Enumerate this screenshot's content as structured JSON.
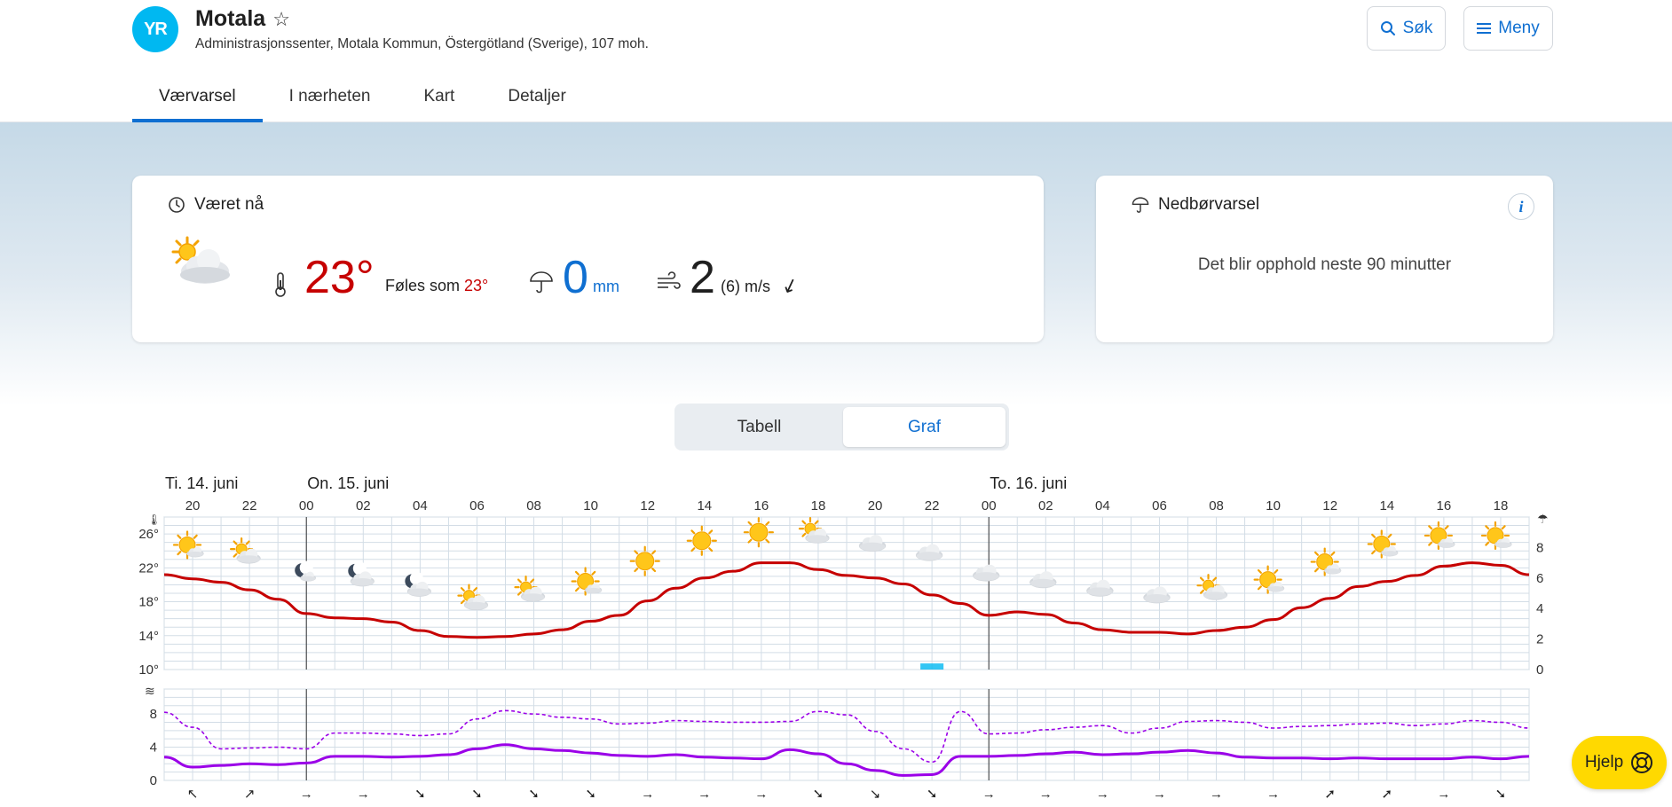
{
  "app": {
    "logo_text": "YR",
    "location_name": "Motala",
    "location_sub": "Administrasjonssenter, Motala Kommun, Östergötland (Sverige), 107 moh.",
    "search_label": "Søk",
    "menu_label": "Meny",
    "icons": {
      "logo": "yr-logo-icon",
      "star": "star-icon",
      "search": "search-icon",
      "menu": "hamburger-icon"
    }
  },
  "tabs": [
    {
      "label": "Værvarsel",
      "active": true
    },
    {
      "label": "I nærheten",
      "active": false
    },
    {
      "label": "Kart",
      "active": false
    },
    {
      "label": "Detaljer",
      "active": false
    }
  ],
  "now": {
    "title": "Været nå",
    "temperature": "23°",
    "feels_label": "Føles som",
    "feels_value": "23°",
    "precip_value": "0",
    "precip_unit": "mm",
    "wind_value": "2",
    "wind_detail": "(6) m/s",
    "wind_arrow": "↙",
    "icons": {
      "clock": "clock-icon",
      "weather": "partly-cloudy-day-icon",
      "thermometer": "thermometer-icon",
      "umbrella": "umbrella-icon",
      "wind": "wind-icon"
    }
  },
  "precip_card": {
    "title": "Nedbørvarsel",
    "message": "Det blir opphold neste 90 minutter",
    "info_label": "i"
  },
  "view_toggle": {
    "table_label": "Tabell",
    "graph_label": "Graf",
    "selected": "Graf"
  },
  "help": {
    "label": "Hjelp"
  },
  "colors": {
    "accent": "#0f6fd1",
    "temp": "#c60000",
    "wind": "#9b00e8",
    "rain": "#00b8f1",
    "help": "#ffd900"
  },
  "chart_data": {
    "type": "line",
    "days": [
      {
        "label": "Ti. 14. juni",
        "start_hour": 19
      },
      {
        "label": "On. 15. juni",
        "start_hour": 0
      },
      {
        "label": "To. 16. juni",
        "start_hour": 0
      }
    ],
    "hour_ticks": [
      "20",
      "22",
      "00",
      "02",
      "04",
      "06",
      "08",
      "10",
      "12",
      "14",
      "16",
      "18",
      "20",
      "22",
      "00",
      "02",
      "04",
      "06",
      "08",
      "10",
      "12",
      "14",
      "16",
      "18"
    ],
    "x": [
      "19",
      "20",
      "21",
      "22",
      "23",
      "00",
      "01",
      "02",
      "03",
      "04",
      "05",
      "06",
      "07",
      "08",
      "09",
      "10",
      "11",
      "12",
      "13",
      "14",
      "15",
      "16",
      "17",
      "18",
      "19",
      "20",
      "21",
      "22",
      "23",
      "00",
      "01",
      "02",
      "03",
      "04",
      "05",
      "06",
      "07",
      "08",
      "09",
      "10",
      "11",
      "12",
      "13",
      "14",
      "15",
      "16",
      "17",
      "18",
      "19"
    ],
    "temperature_axis": {
      "ticks": [
        "26°",
        "22°",
        "18°",
        "14°",
        "10°"
      ],
      "ylim": [
        10,
        28
      ]
    },
    "precip_axis": {
      "ticks": [
        "8",
        "6",
        "4",
        "2",
        "0"
      ],
      "ylim": [
        0,
        10
      ]
    },
    "wind_axis": {
      "ticks": [
        "8",
        "4",
        "0"
      ],
      "ylim": [
        0,
        11
      ]
    },
    "series": [
      {
        "name": "temperature",
        "unit": "°C",
        "values": [
          21.2,
          20.7,
          20.3,
          19.4,
          18.3,
          16.6,
          16.1,
          16.0,
          15.6,
          14.6,
          13.9,
          13.8,
          13.9,
          14.2,
          14.7,
          15.7,
          16.4,
          18.1,
          19.6,
          20.8,
          21.6,
          22.6,
          22.6,
          21.8,
          21.1,
          20.8,
          20.1,
          18.8,
          17.8,
          16.4,
          16.8,
          16.5,
          15.5,
          14.7,
          14.4,
          14.4,
          14.2,
          14.6,
          15.0,
          15.9,
          17.3,
          18.4,
          19.8,
          20.4,
          21.1,
          22.2,
          22.6,
          22.3,
          21.2
        ]
      },
      {
        "name": "wind",
        "unit": "m/s",
        "values": [
          2.8,
          1.6,
          1.8,
          2.0,
          1.9,
          2.1,
          2.9,
          2.9,
          2.8,
          2.9,
          3.1,
          3.8,
          4.3,
          3.8,
          3.6,
          3.3,
          3.0,
          2.9,
          3.1,
          2.8,
          2.7,
          2.6,
          3.7,
          3.2,
          2.0,
          1.2,
          0.6,
          0.7,
          2.9,
          2.9,
          3.0,
          3.2,
          3.4,
          3.1,
          3.2,
          3.4,
          3.6,
          3.3,
          2.8,
          2.7,
          2.7,
          2.6,
          2.7,
          2.6,
          2.6,
          2.6,
          2.8,
          2.6,
          2.9
        ]
      },
      {
        "name": "wind_gust",
        "unit": "m/s",
        "values": [
          8.2,
          6.4,
          3.8,
          3.9,
          4.0,
          3.8,
          5.7,
          5.7,
          5.6,
          5.4,
          5.6,
          7.4,
          8.4,
          8.0,
          7.6,
          7.4,
          6.8,
          6.9,
          7.2,
          7.1,
          7.0,
          7.0,
          7.1,
          8.3,
          7.9,
          5.9,
          3.8,
          2.2,
          8.3,
          5.6,
          5.7,
          6.1,
          6.4,
          6.6,
          5.7,
          6.3,
          7.1,
          7.2,
          7.0,
          6.3,
          6.5,
          6.6,
          6.8,
          6.9,
          6.6,
          6.8,
          7.2,
          7.0,
          6.3
        ]
      },
      {
        "name": "precipitation",
        "unit": "mm",
        "values": [
          0,
          0,
          0,
          0,
          0,
          0,
          0,
          0,
          0,
          0,
          0,
          0,
          0,
          0,
          0,
          0,
          0,
          0,
          0,
          0,
          0,
          0,
          0,
          0,
          0,
          0,
          0,
          0.4,
          0,
          0,
          0,
          0,
          0,
          0,
          0,
          0,
          0,
          0,
          0,
          0,
          0,
          0,
          0,
          0,
          0,
          0,
          0,
          0,
          0
        ]
      }
    ],
    "symbols": [
      "partly-sunny-icon",
      "partly-cloudy-day-icon",
      "moon-icon",
      "partly-cloudy-night-icon",
      "partly-cloudy-night-icon",
      "partly-cloudy-day-icon",
      "partly-cloudy-day-icon",
      "partly-sunny-icon",
      "sun-icon",
      "sun-icon",
      "sun-icon",
      "partly-cloudy-day-icon",
      "cloud-icon",
      "cloud-icon",
      "cloud-icon",
      "cloud-icon",
      "cloud-icon",
      "cloud-icon",
      "partly-cloudy-day-icon",
      "partly-sunny-icon",
      "partly-sunny-icon",
      "partly-sunny-icon",
      "partly-sunny-icon",
      "partly-sunny-icon"
    ],
    "symbol_temps": [
      24.5,
      23.7,
      21.5,
      21.0,
      19.8,
      18.2,
      19.2,
      20.2,
      22.8,
      25.2,
      26.2,
      26.1,
      24.9,
      23.8,
      21.4,
      20.6,
      19.6,
      18.8,
      19.4,
      20.4,
      22.5,
      24.6,
      25.6,
      25.6
    ],
    "wind_dirs": [
      "↖",
      "↗",
      "→",
      "→",
      "➘",
      "➘",
      "➘",
      "➘",
      "→",
      "→",
      "→",
      "➘",
      "↘",
      "➘",
      "→",
      "→",
      "→",
      "→",
      "→",
      "→",
      "➚",
      "➚",
      "→",
      "➘"
    ],
    "grid": true
  }
}
